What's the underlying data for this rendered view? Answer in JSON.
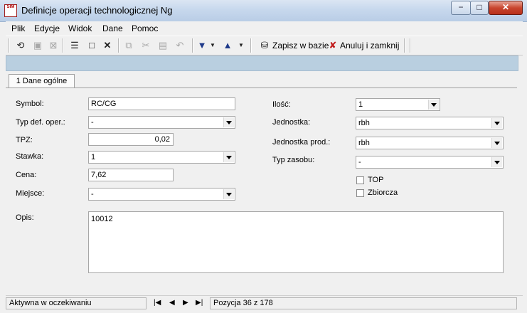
{
  "window": {
    "title": "Definicje operacji technologicznej Ng",
    "icon_text": "SIM",
    "controls": {
      "minimize": "−",
      "maximize": "□",
      "close": "✕"
    }
  },
  "menu": [
    {
      "label": "Plik",
      "accel": "P"
    },
    {
      "label": "Edycje",
      "accel": "E"
    },
    {
      "label": "Widok",
      "accel": "W"
    },
    {
      "label": "Dane",
      "accel": "D"
    },
    {
      "label": "Pomoc",
      "accel": "c"
    }
  ],
  "toolbar": {
    "save_label": "Zapisz w bazie",
    "cancel_label": "Anuluj i zamknij"
  },
  "tabs": [
    {
      "label": "1 Dane ogólne"
    }
  ],
  "form": {
    "symbol": {
      "label": "Symbol:",
      "value": "RC/CG"
    },
    "typ_def_oper": {
      "label": "Typ def. oper.:",
      "value": "-"
    },
    "tpz": {
      "label": "TPZ:",
      "value": "0,02"
    },
    "stawka": {
      "label": "Stawka:",
      "value": "1"
    },
    "cena": {
      "label": "Cena:",
      "value": "7,62"
    },
    "miejsce": {
      "label": "Miejsce:",
      "value": "-"
    },
    "ilosc": {
      "label": "Ilość:",
      "value": "1"
    },
    "jednostka": {
      "label": "Jednostka:",
      "value": "rbh"
    },
    "jednostka_prod": {
      "label": "Jednostka prod.:",
      "value": "rbh"
    },
    "typ_zasobu": {
      "label": "Typ zasobu:",
      "value": "-"
    },
    "top": {
      "label": "TOP",
      "checked": false
    },
    "zbiorcza": {
      "label": "Zbiorcza",
      "checked": false
    },
    "opis": {
      "label": "Opis:",
      "value": "10012"
    }
  },
  "status": {
    "state": "Aktywna w oczekiwaniu",
    "position": "Pozycja 36 z 178"
  }
}
